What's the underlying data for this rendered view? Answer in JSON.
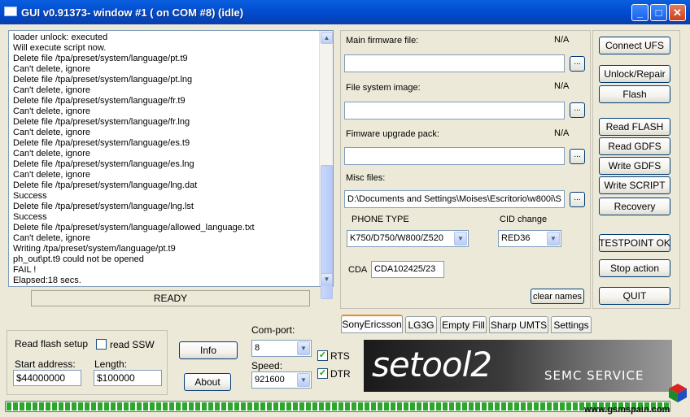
{
  "titlebar": {
    "title": "GUI v0.91373- window #1 ( on COM #8) (idle)",
    "minimize": "_",
    "maximize": "□",
    "close": "✕"
  },
  "log": {
    "lines": [
      "loader unlock: executed",
      "Will execute script now.",
      "Delete file /tpa/preset/system/language/pt.t9",
      "Can't delete, ignore",
      "Delete file /tpa/preset/system/language/pt.lng",
      "Can't delete, ignore",
      "Delete file /tpa/preset/system/language/fr.t9",
      "Can't delete, ignore",
      "Delete file /tpa/preset/system/language/fr.lng",
      "Can't delete, ignore",
      "Delete file /tpa/preset/system/language/es.t9",
      "Can't delete, ignore",
      "Delete file /tpa/preset/system/language/es.lng",
      "Can't delete, ignore",
      "Delete file /tpa/preset/system/language/lng.dat",
      "Success",
      "Delete file /tpa/preset/system/language/lng.lst",
      "Success",
      "Delete file /tpa/preset/system/language/allowed_language.txt",
      "Can't delete, ignore",
      "Writing /tpa/preset/system/language/pt.t9",
      "ph_out\\pt.t9 could not be opened",
      "FAIL !",
      "Elapsed:18 secs."
    ]
  },
  "status": "READY",
  "files": {
    "main_firmware_label": "Main firmware file:",
    "main_firmware_status": "N/A",
    "main_firmware_value": "",
    "fs_image_label": "File system image:",
    "fs_image_status": "N/A",
    "fs_image_value": "",
    "upgrade_pack_label": "Fimware upgrade pack:",
    "upgrade_pack_status": "N/A",
    "upgrade_pack_value": "",
    "misc_label": "Misc files:",
    "misc_value": "D:\\Documents and Settings\\Moises\\Escritorio\\w800i\\S",
    "browse": "..."
  },
  "phone": {
    "phone_type_label": "PHONE TYPE",
    "phone_type_value": "K750/D750/W800/Z520",
    "cid_label": "CID change",
    "cid_value": "RED36",
    "cda_label": "CDA",
    "cda_value": "CDA102425/23",
    "clear_names": "clear names"
  },
  "side_buttons": {
    "connect": "Connect UFS",
    "unlock": "Unlock/Repair",
    "flash": "Flash",
    "read_flash": "Read FLASH",
    "read_gdfs": "Read GDFS",
    "write_gdfs": "Write GDFS",
    "write_script": "Write SCRIPT",
    "recovery": "Recovery",
    "testpoint": "TESTPOINT OK",
    "stop": "Stop action",
    "quit": "QUIT"
  },
  "tabs": [
    "SonyEricsson",
    "LG3G",
    "Empty Fill",
    "Sharp UMTS",
    "Settings"
  ],
  "read_flash_setup": {
    "title": "Read flash setup",
    "read_ssw_label": "read SSW",
    "read_ssw_checked": false,
    "start_label": "Start address:",
    "start_value": "$44000000",
    "length_label": "Length:",
    "length_value": "$100000"
  },
  "bottom_buttons": {
    "info": "Info",
    "about": "About"
  },
  "comport": {
    "label": "Com-port:",
    "value": "8",
    "speed_label": "Speed:",
    "speed_value": "921600",
    "rts_label": "RTS",
    "rts_checked": true,
    "dtr_label": "DTR",
    "dtr_checked": true
  },
  "banner": {
    "logo": "setool2",
    "subtitle": "SEMC SERVICE"
  },
  "progress": {
    "fraction": 1.0
  },
  "watermark": "www.gsmspain.com"
}
